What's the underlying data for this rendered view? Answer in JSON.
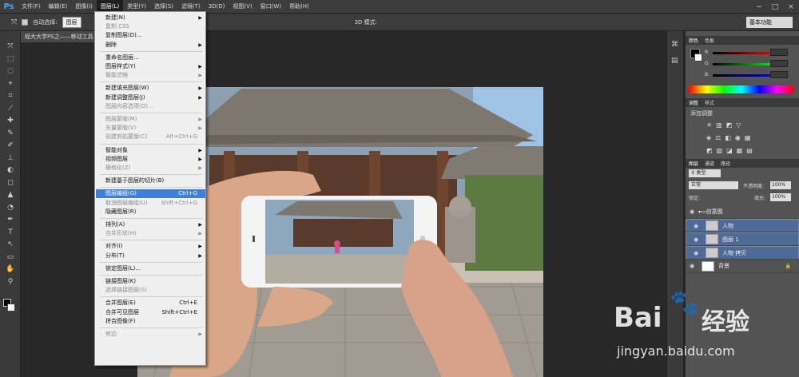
{
  "app": {
    "logo": "Ps"
  },
  "menubar": {
    "items": [
      "文件(F)",
      "编辑(E)",
      "图像(I)",
      "图层(L)",
      "类型(Y)",
      "选择(S)",
      "滤镜(T)",
      "3D(D)",
      "视图(V)",
      "窗口(W)",
      "帮助(H)"
    ],
    "active_index": 3
  },
  "options": {
    "auto_select_label": "自动选择:",
    "auto_select_value": "图层",
    "mode_label": "3D 模式:",
    "workspace": "基本功能"
  },
  "document": {
    "tab_title": "程大大学PS之——移动工具"
  },
  "layer_menu": [
    {
      "label": "新建(N)",
      "arrow": true
    },
    {
      "label": "复制 CSS",
      "disabled": true
    },
    {
      "label": "复制图层(D)..."
    },
    {
      "label": "删除",
      "arrow": true
    },
    {
      "sep": true
    },
    {
      "label": "重命名图层..."
    },
    {
      "label": "图层样式(Y)",
      "arrow": true
    },
    {
      "label": "智能滤镜",
      "disabled": true,
      "arrow": true
    },
    {
      "sep": true
    },
    {
      "label": "新建填充图层(W)",
      "arrow": true
    },
    {
      "label": "新建调整图层(J)",
      "arrow": true
    },
    {
      "label": "图层内容选项(O)...",
      "disabled": true
    },
    {
      "sep": true
    },
    {
      "label": "图层蒙版(M)",
      "disabled": true,
      "arrow": true
    },
    {
      "label": "矢量蒙版(V)",
      "disabled": true,
      "arrow": true
    },
    {
      "label": "创建剪贴蒙版(C)",
      "disabled": true,
      "shortcut": "Alt+Ctrl+G"
    },
    {
      "sep": true
    },
    {
      "label": "智能对象",
      "arrow": true
    },
    {
      "label": "视频图层",
      "arrow": true
    },
    {
      "label": "栅格化(Z)",
      "disabled": true,
      "arrow": true
    },
    {
      "sep": true
    },
    {
      "label": "新建基于图层的切片(B)"
    },
    {
      "sep": true
    },
    {
      "label": "图层编组(G)",
      "shortcut": "Ctrl+G",
      "highlight": true
    },
    {
      "label": "取消图层编组(U)",
      "disabled": true,
      "shortcut": "Shift+Ctrl+G"
    },
    {
      "label": "隐藏图层(R)"
    },
    {
      "sep": true
    },
    {
      "label": "排列(A)",
      "arrow": true
    },
    {
      "label": "合并形状(H)",
      "disabled": true,
      "arrow": true
    },
    {
      "sep": true
    },
    {
      "label": "对齐(I)",
      "arrow": true
    },
    {
      "label": "分布(T)",
      "arrow": true
    },
    {
      "sep": true
    },
    {
      "label": "锁定图层(L)..."
    },
    {
      "sep": true
    },
    {
      "label": "链接图层(K)"
    },
    {
      "label": "选择链接图层(S)",
      "disabled": true
    },
    {
      "sep": true
    },
    {
      "label": "合并图层(E)",
      "shortcut": "Ctrl+E"
    },
    {
      "label": "合并可见图层",
      "shortcut": "Shift+Ctrl+E"
    },
    {
      "label": "拼合图像(F)"
    },
    {
      "sep": true
    },
    {
      "label": "修边",
      "disabled": true,
      "arrow": true
    }
  ],
  "panels": {
    "color_tabs": [
      "颜色",
      "色板"
    ],
    "color_channels": [
      "R",
      "G",
      "B"
    ],
    "adjust_tabs": [
      "调整",
      "样式"
    ],
    "adjust_title": "添加调整",
    "layers_tabs": [
      "图层",
      "通道",
      "路径"
    ],
    "filter_kind": "类型",
    "blend_mode": "正常",
    "opacity_label": "不透明度:",
    "opacity": "100%",
    "lock_label": "锁定:",
    "fill_label": "填充:",
    "fill": "100%",
    "layers": [
      {
        "name": "创意图",
        "group": true,
        "selected": false
      },
      {
        "name": "人物",
        "selected": true
      },
      {
        "name": "图层 1",
        "selected": true
      },
      {
        "name": "人物 拷贝",
        "selected": true
      },
      {
        "name": "背景",
        "selected": false,
        "locked": true
      }
    ]
  },
  "watermark": {
    "brand": "Bai",
    "brand_cn": "经验",
    "url": "jingyan.baidu.com"
  }
}
